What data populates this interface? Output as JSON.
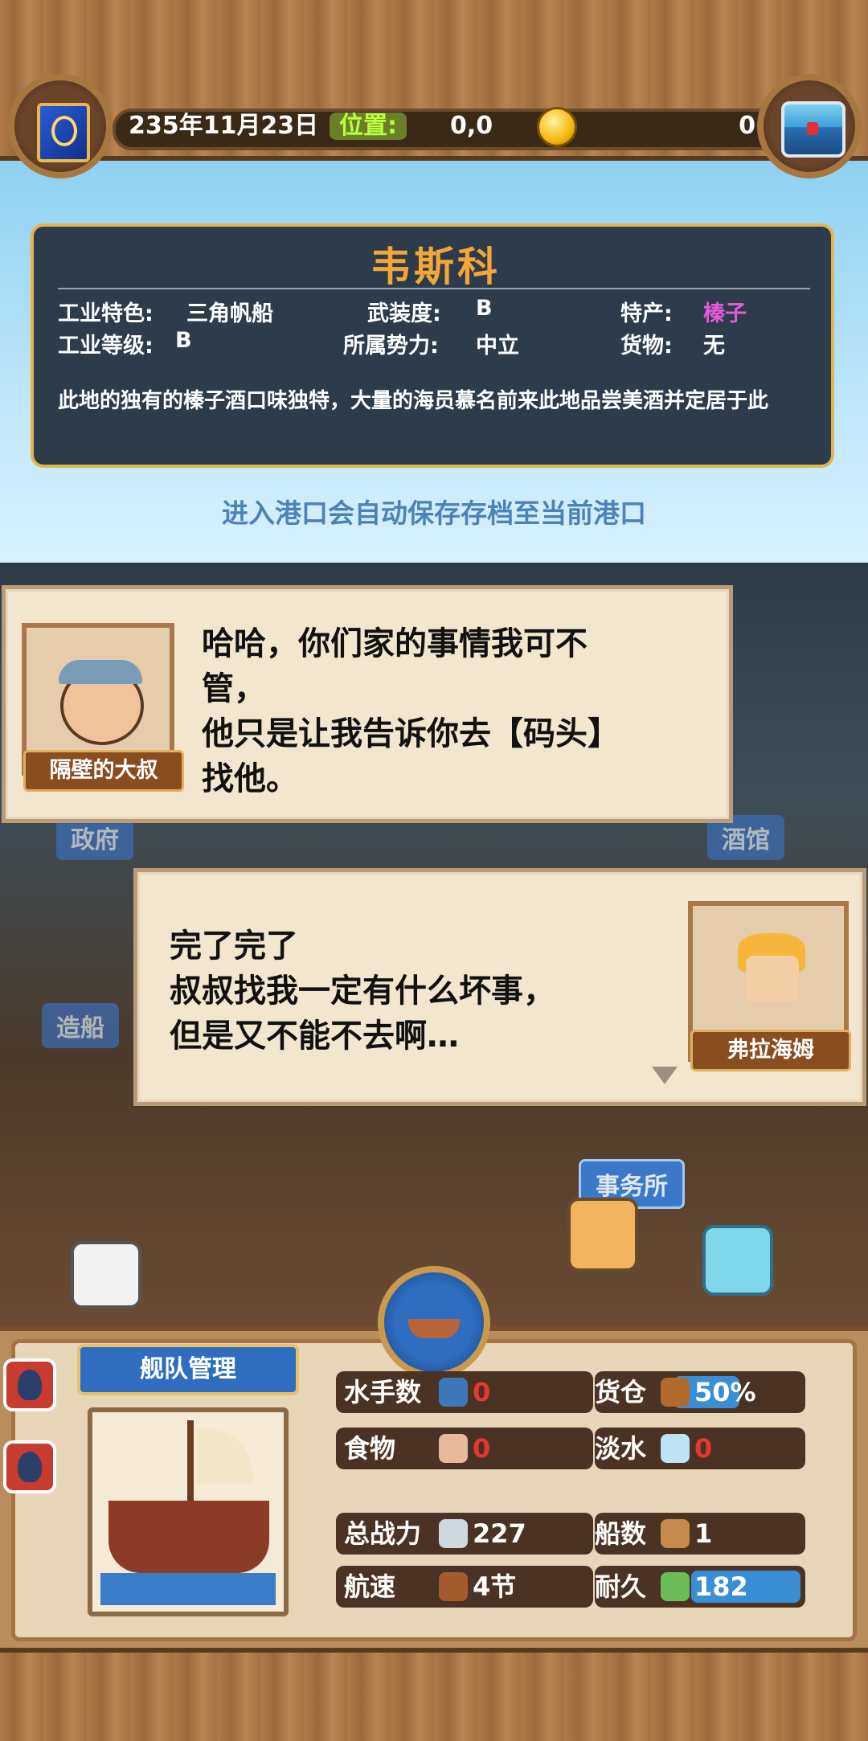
{
  "header": {
    "date": "235年11月23日",
    "position_label": "位置:",
    "position_value": "0,0",
    "coins": "0"
  },
  "port": {
    "name": "韦斯科",
    "fields": [
      {
        "label": "工业特色:",
        "value": "三角帆船"
      },
      {
        "label": "武装度:",
        "value": "B"
      },
      {
        "label": "特产:",
        "value": "榛子"
      },
      {
        "label": "工业等级:",
        "value": "B"
      },
      {
        "label": "所属势力:",
        "value": "中立"
      },
      {
        "label": "货物:",
        "value": "无"
      }
    ],
    "description": "此地的独有的榛子酒口味独特，大量的海员慕名前来此地品尝美酒并定居于此",
    "specialty_color": "#e45ad9"
  },
  "autosave_hint": "进入港口会自动保存存档至当前港口",
  "town": {
    "buildings": [
      "政府",
      "酒馆",
      "造船",
      "事务所"
    ]
  },
  "dialogs": [
    {
      "speaker": "隔壁的大叔",
      "text": "哈哈，你们家的事情我可不\n管，\n他只是让我告诉你去【码头】\n找他。"
    },
    {
      "speaker": "弗拉海姆",
      "text": "完了完了\n叔叔找我一定有什么坏事，\n但是又不能不去啊…"
    }
  ],
  "fleet": {
    "title": "舰队管理",
    "stats": [
      {
        "label": "水手数",
        "value": "0",
        "icon": "sailor-icon"
      },
      {
        "label": "货仓",
        "value": "50%",
        "icon": "crate-icon",
        "fill": 0.5
      },
      {
        "label": "食物",
        "value": "0",
        "icon": "meat-icon"
      },
      {
        "label": "淡水",
        "value": "0",
        "icon": "water-jug-icon"
      },
      {
        "label": "总战力",
        "value": "227",
        "icon": "crossed-swords-icon"
      },
      {
        "label": "船数",
        "value": "1",
        "icon": "ship-icon"
      },
      {
        "label": "航速",
        "value": "4节",
        "icon": "ship-icon"
      },
      {
        "label": "耐久",
        "value": "182",
        "icon": "wreath-icon",
        "fill": 1.0
      }
    ],
    "colors": {
      "zero": "#e8372f",
      "accent": "#3a8fd4"
    }
  }
}
